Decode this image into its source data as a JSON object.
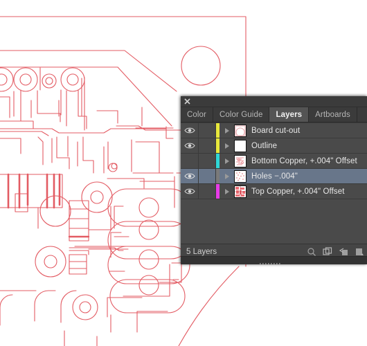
{
  "app": {
    "panel_title": "Layers",
    "close_icon": "close-icon"
  },
  "tabs": [
    {
      "label": "Color",
      "active": false,
      "name": "tab-color"
    },
    {
      "label": "Color Guide",
      "active": false,
      "name": "tab-color-guide"
    },
    {
      "label": "Layers",
      "active": true,
      "name": "tab-layers"
    },
    {
      "label": "Artboards",
      "active": false,
      "name": "tab-artboards"
    }
  ],
  "layers": [
    {
      "name": "Board cut-out",
      "visible": true,
      "locked": false,
      "selected": false,
      "expanded": false,
      "color": "#e8e83c",
      "thumbnail": "board-outline-circle"
    },
    {
      "name": "Outline",
      "visible": true,
      "locked": false,
      "selected": false,
      "expanded": false,
      "color": "#e8e83c",
      "thumbnail": "empty-white"
    },
    {
      "name": "Bottom Copper, +.004\" Offset",
      "visible": false,
      "locked": false,
      "selected": false,
      "expanded": false,
      "color": "#2fd6d6",
      "thumbnail": "sparse-red-traces"
    },
    {
      "name": "Holes −.004\"",
      "visible": true,
      "locked": false,
      "selected": true,
      "expanded": false,
      "color": "#7a7a7a",
      "thumbnail": "scattered-red-dots"
    },
    {
      "name": "Top Copper, +.004\" Offset",
      "visible": true,
      "locked": false,
      "selected": false,
      "expanded": false,
      "color": "#e83ce8",
      "thumbnail": "dense-red-pattern"
    }
  ],
  "footer": {
    "count_label": "5 Layers",
    "icons": [
      {
        "name": "locate-object-icon",
        "glyph": "magnifier"
      },
      {
        "name": "make-sublayer-icon",
        "glyph": "squares"
      },
      {
        "name": "new-layer-icon",
        "glyph": "arrow-page"
      },
      {
        "name": "delete-layer-icon",
        "glyph": "page"
      }
    ]
  },
  "artwork": {
    "description": "PCB copper trace outlines",
    "stroke_color": "#e35b63",
    "background": "#ffffff"
  },
  "colors": {
    "panel_bg": "#4a4a4a",
    "tab_bg": "#3b3b3b",
    "tab_active_bg": "#545454",
    "row_selected_bg": "#68768a",
    "text": "#e8e8e8",
    "footer_bg": "#454545",
    "dock_bg": "#333333"
  }
}
